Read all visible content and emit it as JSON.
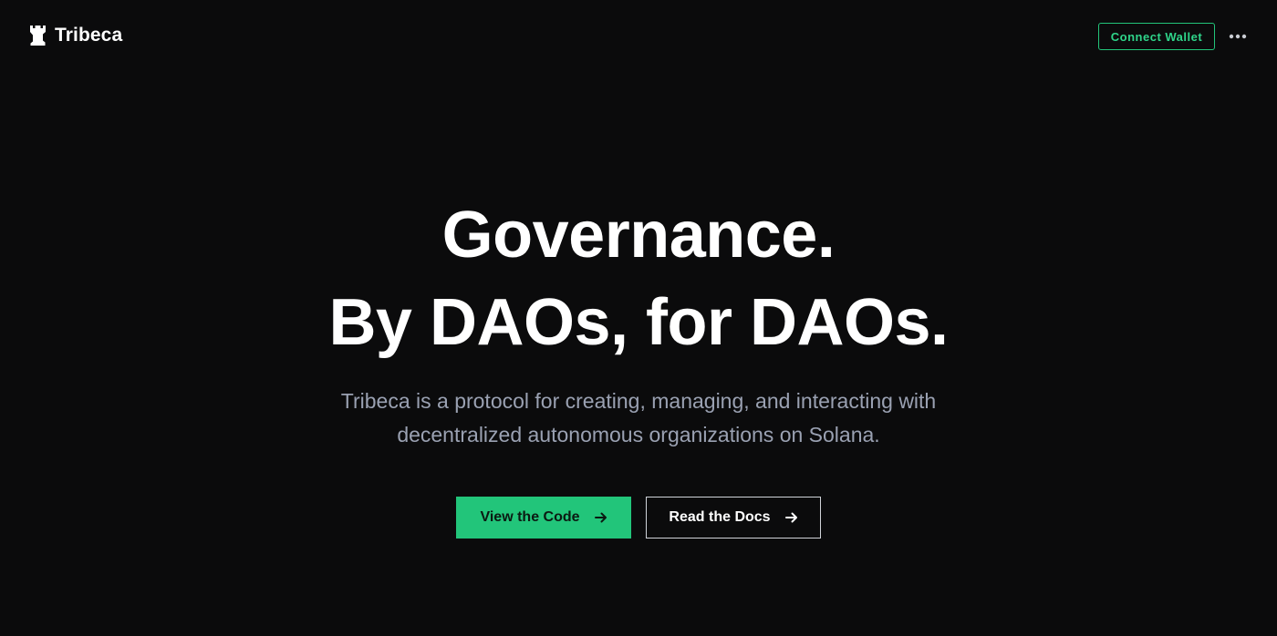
{
  "header": {
    "brand_name": "Tribeca",
    "brand_icon": "rook-icon",
    "connect_wallet_label": "Connect Wallet",
    "more_icon": "more-horizontal-icon"
  },
  "hero": {
    "headline_line1": "Governance.",
    "headline_line2": "By DAOs, for DAOs.",
    "subtitle_line1": "Tribeca is a protocol for creating, managing, and interacting with",
    "subtitle_line2": "decentralized autonomous organizations on Solana.",
    "primary_cta_label": "View the Code",
    "secondary_cta_label": "Read the Docs",
    "cta_icon": "arrow-right-icon"
  },
  "colors": {
    "background": "#0b0b0c",
    "accent": "#22c57a",
    "accent_text": "#2fd48a",
    "subtitle": "#9aa1b2"
  }
}
